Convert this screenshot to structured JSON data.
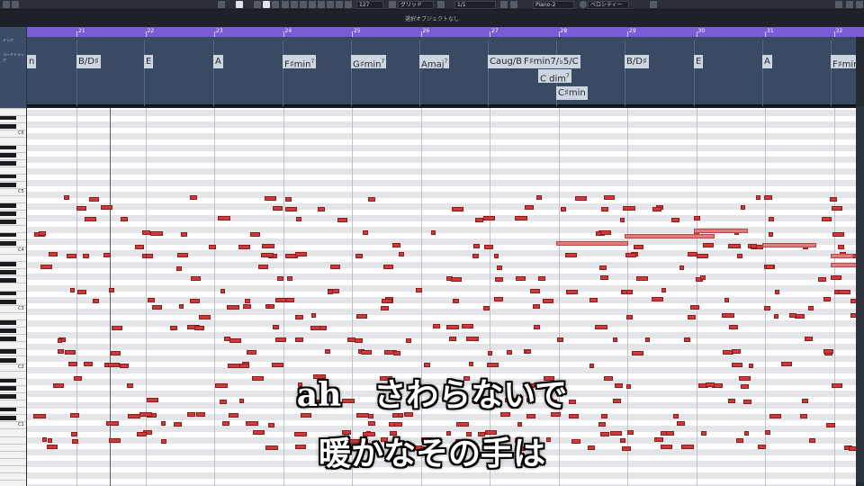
{
  "toolbar": {
    "quantize_value": "127",
    "snap_mode": "グリッド",
    "grid_value": "1/1",
    "instrument": "Piano-2",
    "velocity_label": "ベロシティー"
  },
  "info_line": "選択オブジェクトなし",
  "left_strip": {
    "top_label": "ドック",
    "chord_label": "コードトラック"
  },
  "ruler": {
    "bars": [
      "21",
      "22",
      "23",
      "24",
      "25",
      "26",
      "27",
      "28",
      "29",
      "30",
      "31",
      "32"
    ]
  },
  "chords": [
    {
      "root": "",
      "qual": "n",
      "sup": ""
    },
    {
      "root": "B/D♯",
      "qual": "",
      "sup": ""
    },
    {
      "root": "E",
      "qual": "",
      "sup": ""
    },
    {
      "root": "A",
      "qual": "",
      "sup": ""
    },
    {
      "root": "F♯min",
      "qual": "",
      "sup": "7"
    },
    {
      "root": "G♯min",
      "qual": "",
      "sup": "7"
    },
    {
      "root": "Amaj",
      "qual": "",
      "sup": "7"
    },
    {
      "root": "Caug/B",
      "qual": "",
      "sup": ""
    },
    {
      "root": "F♯min7/♭5/C",
      "qual": "",
      "sup": ""
    },
    {
      "root": "C dim",
      "qual": "",
      "sup": "7"
    },
    {
      "root": "C♯min",
      "qual": "",
      "sup": ""
    },
    {
      "root": "B/D♯",
      "qual": "",
      "sup": ""
    },
    {
      "root": "E",
      "qual": "",
      "sup": ""
    },
    {
      "root": "A",
      "qual": "",
      "sup": ""
    },
    {
      "root": "F♯min",
      "qual": "",
      "sup": "7"
    }
  ],
  "keyboard": {
    "octaves": [
      "C6",
      "C5",
      "C4",
      "C3",
      "C2",
      "C1"
    ]
  },
  "lyrics": {
    "line1": "ah　さわらないで",
    "line2": "暖かなその手は"
  },
  "colors": {
    "ruler": "#7b5bd8",
    "note": "#cc3b3b",
    "note_highlight": "#e27b7b",
    "chord_track": "#3a4a63"
  }
}
